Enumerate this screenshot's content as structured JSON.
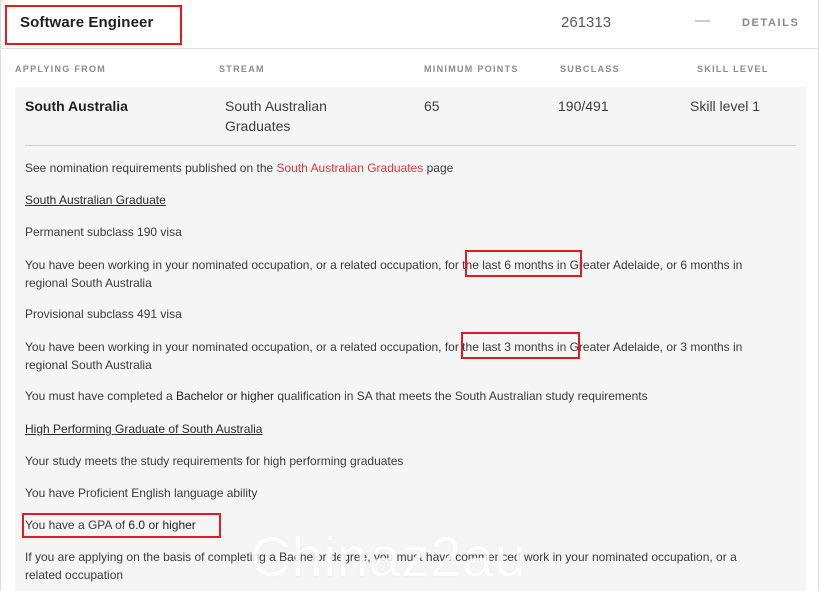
{
  "occupation": {
    "title": "Software Engineer",
    "anzsco_code": "261313",
    "collapse_symbol": "—",
    "details_label": "DETAILS"
  },
  "columns": {
    "applying_from": "APPLYING FROM",
    "stream": "STREAM",
    "minimum_points": "MINIMUM POINTS",
    "subclass": "SUBCLASS",
    "skill_level": "SKILL LEVEL"
  },
  "row": {
    "applying_from": "South Australia",
    "stream_line1": "South Australian",
    "stream_line2": "Graduates",
    "minimum_points": "65",
    "subclass": "190/491",
    "skill_level": "Skill level 1"
  },
  "details": {
    "nomination_prefix": "See nomination requirements published on the ",
    "nomination_link": "South Australian Graduates",
    "nomination_suffix": " page",
    "sa_graduate_heading": "South Australian Graduate",
    "perm_190_heading": "Permanent subclass 190 visa",
    "perm_190_prefix": "You have been working in your nominated occupation, or a related occupation, ",
    "perm_190_period": "for the last 6 months",
    "perm_190_suffix": " in Greater Adelaide, or 6 months in",
    "perm_190_line2": "regional South Australia",
    "prov_491_heading": "Provisional subclass 491 visa",
    "prov_491_prefix": "You have been working in your nominated occupation, or a related occupation, ",
    "prov_491_period": "for the last 3 months",
    "prov_491_suffix": " in Greater Adelaide, or 3 months in",
    "prov_491_line2": "regional South Australia",
    "bachelor_prefix": "You must have completed a ",
    "bachelor_bold": "Bachelor or higher",
    "bachelor_suffix": " qualification in SA that meets the South Australian study requirements",
    "hpg_heading": "High Performing Graduate of South Australia",
    "hpg_study": "Your study meets the study requirements for high performing graduates",
    "hpg_english": "You have Proficient English language ability",
    "gpa_prefix": "You have a GPA of ",
    "gpa_value": "6.0 or higher",
    "bachelor_basis_line1": "If you are applying on the basis of completing a Bachelor degree, you must have commenced work in your nominated occupation, or a",
    "bachelor_basis_line2": "related occupation"
  },
  "watermark": "Chinaz2au",
  "colors": {
    "highlight_box": "#e11b22",
    "link": "#e8343c",
    "panel_bg": "#f5f5f5"
  }
}
